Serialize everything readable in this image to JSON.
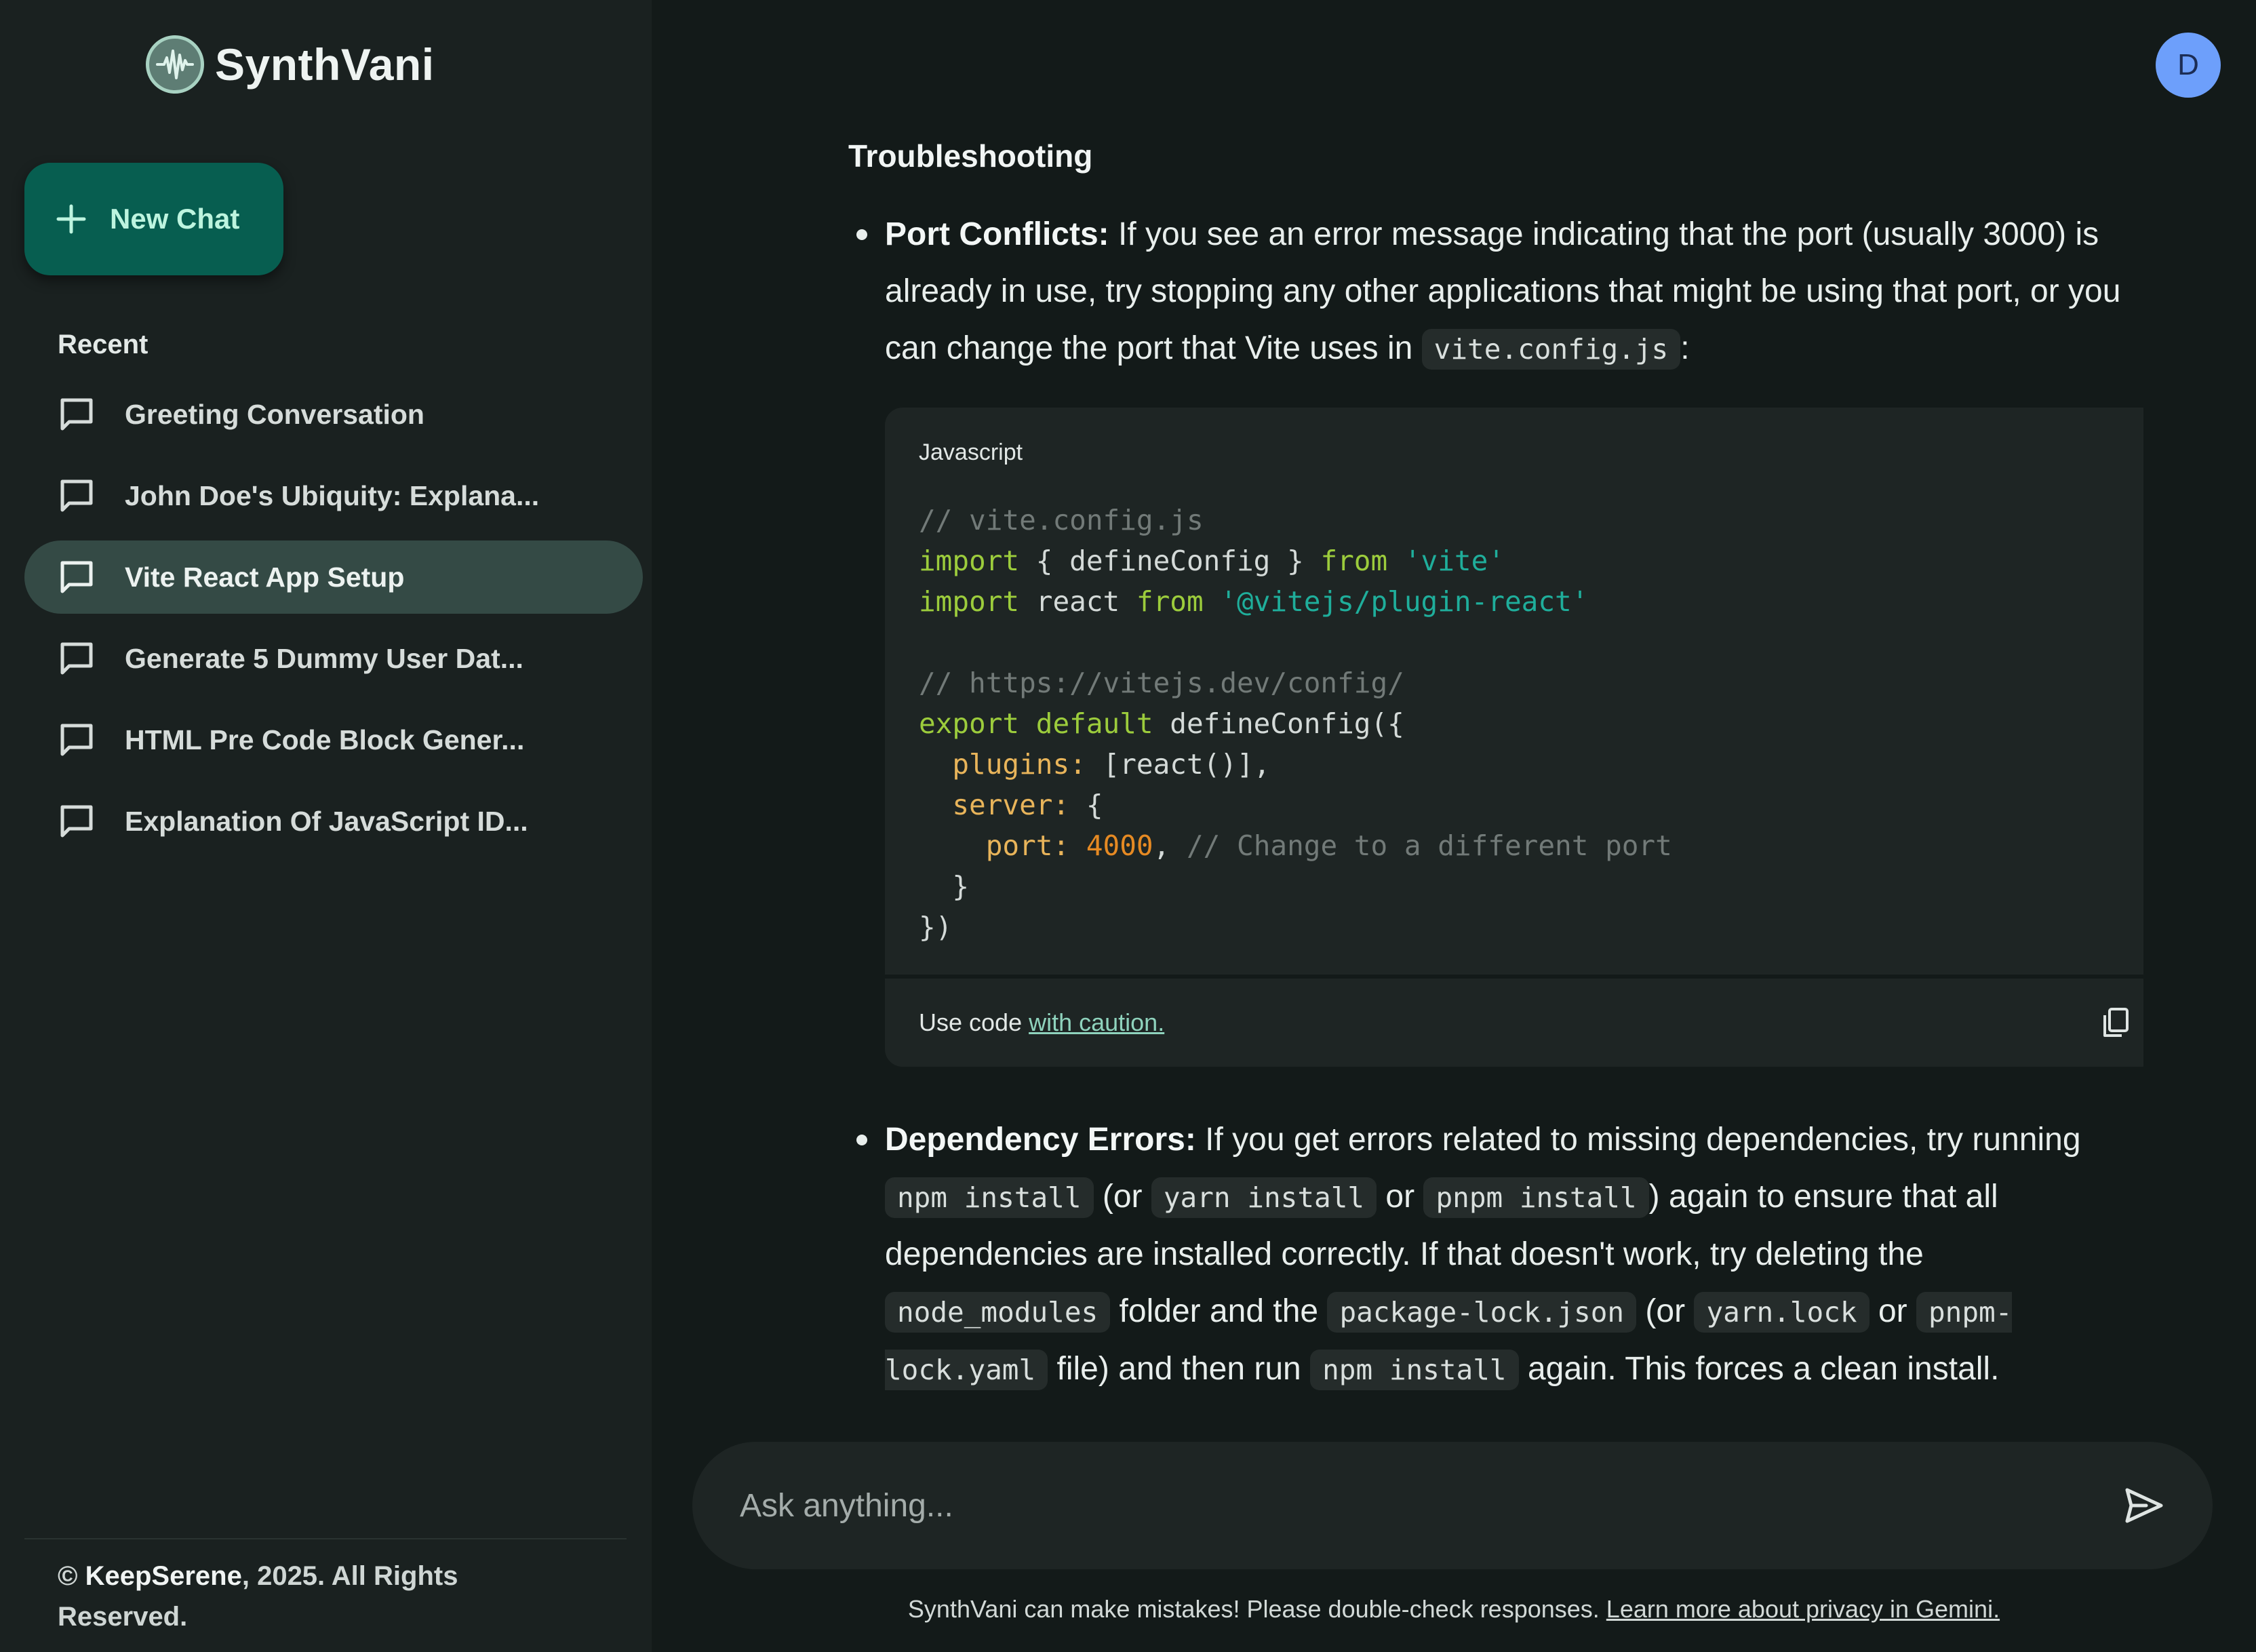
{
  "brand": {
    "name": "SynthVani",
    "logo_icon": "waveform-icon"
  },
  "sidebar": {
    "new_chat_label": "New Chat",
    "recent_title": "Recent",
    "items": [
      {
        "label": "Greeting Conversation",
        "active": false
      },
      {
        "label": "John Doe's Ubiquity: Explana...",
        "active": false
      },
      {
        "label": "Vite React App Setup",
        "active": true
      },
      {
        "label": "Generate 5 Dummy User Dat...",
        "active": false
      },
      {
        "label": "HTML Pre Code Block Gener...",
        "active": false
      },
      {
        "label": "Explanation Of JavaScript ID...",
        "active": false
      }
    ],
    "copyright_symbol": "©",
    "copyright_owner": "KeepSerene",
    "copyright_rest": ", 2025. All Rights Reserved."
  },
  "header": {
    "avatar_initial": "D",
    "avatar_color": "#6d9ffb"
  },
  "response": {
    "heading": "Troubleshooting",
    "bullet1_title": "Port Conflicts:",
    "bullet1_text_a": " If you see an error message indicating that the port (usually 3000) is already in use, try stopping any other applications that might be using that port, or you can change the port that Vite uses in ",
    "bullet1_code": "vite.config.js",
    "bullet1_text_b": ":",
    "code_language": "Javascript",
    "code_footer_text": "Use code ",
    "code_footer_link": "with caution.",
    "code": {
      "l1": "// vite.config.js",
      "l2_kw": "import",
      "l2_mid": " { defineConfig } ",
      "l2_kw2": "from",
      "l2_str": " 'vite'",
      "l3_kw": "import",
      "l3_mid": " react ",
      "l3_kw2": "from",
      "l3_str": " '@vitejs/plugin-react'",
      "l5": "// https://vitejs.dev/config/",
      "l6_kw": "export default",
      "l6_rest": " defineConfig({",
      "l7_prop": "  plugins:",
      "l7_rest": " [react()],",
      "l8_prop": "  server:",
      "l8_rest": " {",
      "l9_prop": "    port:",
      "l9_num": " 4000",
      "l9_punct": ",",
      "l9_comment": " // Change to a different port",
      "l10": "  }",
      "l11": "})"
    },
    "bullet2_title": "Dependency Errors:",
    "bullet2_t1": " If you get errors related to missing dependencies, try running ",
    "bullet2_c1": "npm install",
    "bullet2_t2": " (or ",
    "bullet2_c2": "yarn install",
    "bullet2_t3": " or ",
    "bullet2_c3": "pnpm install",
    "bullet2_t4": ") again to ensure that all dependencies are installed correctly. If that doesn't work, try deleting the ",
    "bullet2_c4": "node_modules",
    "bullet2_t5": " folder and the ",
    "bullet2_c5": "package-lock.json",
    "bullet2_t6": " (or ",
    "bullet2_c6": "yarn.lock",
    "bullet2_t7": " or ",
    "bullet2_c7": "pnpm-lock.yaml",
    "bullet2_t8": " file) and then run ",
    "bullet2_c8": "npm install",
    "bullet2_t9": " again. This forces a clean install."
  },
  "composer": {
    "placeholder": "Ask anything...",
    "value": ""
  },
  "footer": {
    "disclaimer": "SynthVani can make mistakes! Please double-check responses. ",
    "privacy_link": "Learn more about privacy in Gemini."
  },
  "colors": {
    "accent": "#075e50",
    "active_item": "#344a45",
    "background": "#131a19",
    "sidebar": "#1a2120"
  }
}
